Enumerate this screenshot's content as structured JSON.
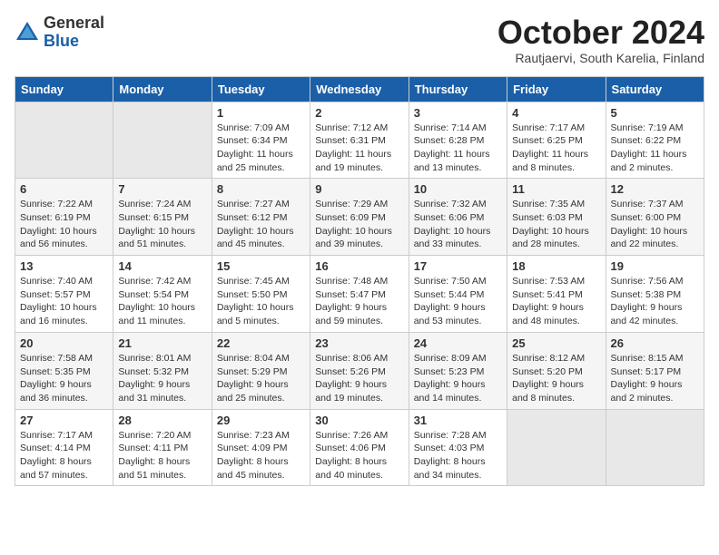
{
  "header": {
    "logo": {
      "line1": "General",
      "line2": "Blue"
    },
    "title": "October 2024",
    "subtitle": "Rautjaervi, South Karelia, Finland"
  },
  "weekdays": [
    "Sunday",
    "Monday",
    "Tuesday",
    "Wednesday",
    "Thursday",
    "Friday",
    "Saturday"
  ],
  "weeks": [
    [
      {
        "day": "",
        "sunrise": "",
        "sunset": "",
        "daylight": ""
      },
      {
        "day": "",
        "sunrise": "",
        "sunset": "",
        "daylight": ""
      },
      {
        "day": "1",
        "sunrise": "Sunrise: 7:09 AM",
        "sunset": "Sunset: 6:34 PM",
        "daylight": "Daylight: 11 hours and 25 minutes."
      },
      {
        "day": "2",
        "sunrise": "Sunrise: 7:12 AM",
        "sunset": "Sunset: 6:31 PM",
        "daylight": "Daylight: 11 hours and 19 minutes."
      },
      {
        "day": "3",
        "sunrise": "Sunrise: 7:14 AM",
        "sunset": "Sunset: 6:28 PM",
        "daylight": "Daylight: 11 hours and 13 minutes."
      },
      {
        "day": "4",
        "sunrise": "Sunrise: 7:17 AM",
        "sunset": "Sunset: 6:25 PM",
        "daylight": "Daylight: 11 hours and 8 minutes."
      },
      {
        "day": "5",
        "sunrise": "Sunrise: 7:19 AM",
        "sunset": "Sunset: 6:22 PM",
        "daylight": "Daylight: 11 hours and 2 minutes."
      }
    ],
    [
      {
        "day": "6",
        "sunrise": "Sunrise: 7:22 AM",
        "sunset": "Sunset: 6:19 PM",
        "daylight": "Daylight: 10 hours and 56 minutes."
      },
      {
        "day": "7",
        "sunrise": "Sunrise: 7:24 AM",
        "sunset": "Sunset: 6:15 PM",
        "daylight": "Daylight: 10 hours and 51 minutes."
      },
      {
        "day": "8",
        "sunrise": "Sunrise: 7:27 AM",
        "sunset": "Sunset: 6:12 PM",
        "daylight": "Daylight: 10 hours and 45 minutes."
      },
      {
        "day": "9",
        "sunrise": "Sunrise: 7:29 AM",
        "sunset": "Sunset: 6:09 PM",
        "daylight": "Daylight: 10 hours and 39 minutes."
      },
      {
        "day": "10",
        "sunrise": "Sunrise: 7:32 AM",
        "sunset": "Sunset: 6:06 PM",
        "daylight": "Daylight: 10 hours and 33 minutes."
      },
      {
        "day": "11",
        "sunrise": "Sunrise: 7:35 AM",
        "sunset": "Sunset: 6:03 PM",
        "daylight": "Daylight: 10 hours and 28 minutes."
      },
      {
        "day": "12",
        "sunrise": "Sunrise: 7:37 AM",
        "sunset": "Sunset: 6:00 PM",
        "daylight": "Daylight: 10 hours and 22 minutes."
      }
    ],
    [
      {
        "day": "13",
        "sunrise": "Sunrise: 7:40 AM",
        "sunset": "Sunset: 5:57 PM",
        "daylight": "Daylight: 10 hours and 16 minutes."
      },
      {
        "day": "14",
        "sunrise": "Sunrise: 7:42 AM",
        "sunset": "Sunset: 5:54 PM",
        "daylight": "Daylight: 10 hours and 11 minutes."
      },
      {
        "day": "15",
        "sunrise": "Sunrise: 7:45 AM",
        "sunset": "Sunset: 5:50 PM",
        "daylight": "Daylight: 10 hours and 5 minutes."
      },
      {
        "day": "16",
        "sunrise": "Sunrise: 7:48 AM",
        "sunset": "Sunset: 5:47 PM",
        "daylight": "Daylight: 9 hours and 59 minutes."
      },
      {
        "day": "17",
        "sunrise": "Sunrise: 7:50 AM",
        "sunset": "Sunset: 5:44 PM",
        "daylight": "Daylight: 9 hours and 53 minutes."
      },
      {
        "day": "18",
        "sunrise": "Sunrise: 7:53 AM",
        "sunset": "Sunset: 5:41 PM",
        "daylight": "Daylight: 9 hours and 48 minutes."
      },
      {
        "day": "19",
        "sunrise": "Sunrise: 7:56 AM",
        "sunset": "Sunset: 5:38 PM",
        "daylight": "Daylight: 9 hours and 42 minutes."
      }
    ],
    [
      {
        "day": "20",
        "sunrise": "Sunrise: 7:58 AM",
        "sunset": "Sunset: 5:35 PM",
        "daylight": "Daylight: 9 hours and 36 minutes."
      },
      {
        "day": "21",
        "sunrise": "Sunrise: 8:01 AM",
        "sunset": "Sunset: 5:32 PM",
        "daylight": "Daylight: 9 hours and 31 minutes."
      },
      {
        "day": "22",
        "sunrise": "Sunrise: 8:04 AM",
        "sunset": "Sunset: 5:29 PM",
        "daylight": "Daylight: 9 hours and 25 minutes."
      },
      {
        "day": "23",
        "sunrise": "Sunrise: 8:06 AM",
        "sunset": "Sunset: 5:26 PM",
        "daylight": "Daylight: 9 hours and 19 minutes."
      },
      {
        "day": "24",
        "sunrise": "Sunrise: 8:09 AM",
        "sunset": "Sunset: 5:23 PM",
        "daylight": "Daylight: 9 hours and 14 minutes."
      },
      {
        "day": "25",
        "sunrise": "Sunrise: 8:12 AM",
        "sunset": "Sunset: 5:20 PM",
        "daylight": "Daylight: 9 hours and 8 minutes."
      },
      {
        "day": "26",
        "sunrise": "Sunrise: 8:15 AM",
        "sunset": "Sunset: 5:17 PM",
        "daylight": "Daylight: 9 hours and 2 minutes."
      }
    ],
    [
      {
        "day": "27",
        "sunrise": "Sunrise: 7:17 AM",
        "sunset": "Sunset: 4:14 PM",
        "daylight": "Daylight: 8 hours and 57 minutes."
      },
      {
        "day": "28",
        "sunrise": "Sunrise: 7:20 AM",
        "sunset": "Sunset: 4:11 PM",
        "daylight": "Daylight: 8 hours and 51 minutes."
      },
      {
        "day": "29",
        "sunrise": "Sunrise: 7:23 AM",
        "sunset": "Sunset: 4:09 PM",
        "daylight": "Daylight: 8 hours and 45 minutes."
      },
      {
        "day": "30",
        "sunrise": "Sunrise: 7:26 AM",
        "sunset": "Sunset: 4:06 PM",
        "daylight": "Daylight: 8 hours and 40 minutes."
      },
      {
        "day": "31",
        "sunrise": "Sunrise: 7:28 AM",
        "sunset": "Sunset: 4:03 PM",
        "daylight": "Daylight: 8 hours and 34 minutes."
      },
      {
        "day": "",
        "sunrise": "",
        "sunset": "",
        "daylight": ""
      },
      {
        "day": "",
        "sunrise": "",
        "sunset": "",
        "daylight": ""
      }
    ]
  ]
}
